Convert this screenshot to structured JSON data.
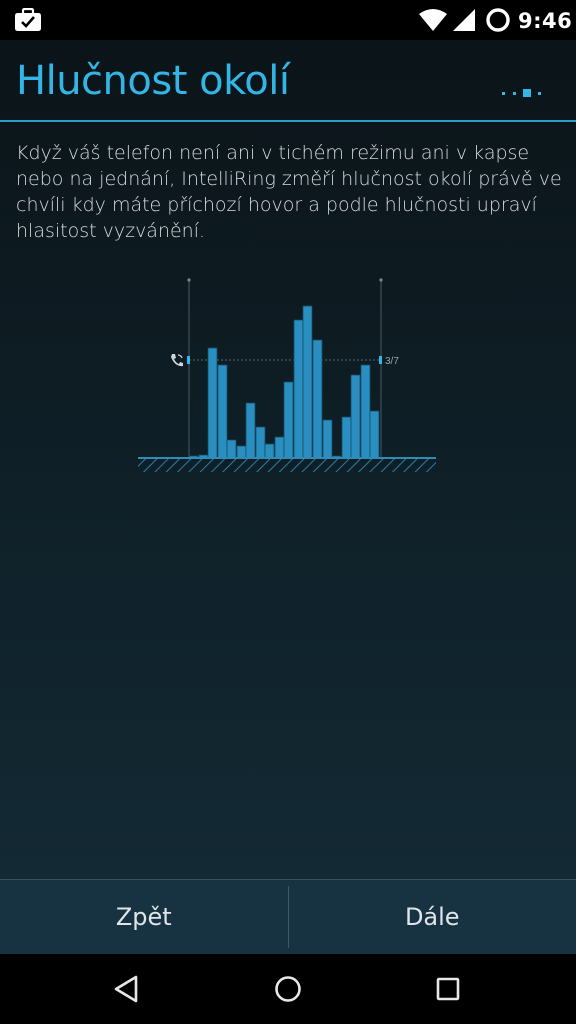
{
  "status_bar": {
    "time": "9:46",
    "icons": [
      "briefcase-icon",
      "wifi-icon",
      "signal-icon",
      "ring-icon"
    ]
  },
  "screen": {
    "title": "Hlučnost okolí",
    "description": "Když váš telefon není ani v tichém režimu ani v kapse nebo na jednání, IntelliRing změří hlučnost okolí právě ve chvíli kdy máte příchozí hovor a podle hlučnosti upraví hlasitost vyzvánění.",
    "page_indicator": {
      "count": 4,
      "active": 3
    }
  },
  "illustration": {
    "level_label": "3/7",
    "icons": [
      "phone-call-icon"
    ],
    "colors": {
      "bars": "#2a8fc0",
      "accent": "#33b5e5"
    }
  },
  "buttons": {
    "back": "Zpět",
    "next": "Dále"
  },
  "nav_bar": {
    "icons": [
      "back-icon",
      "home-icon",
      "recents-icon"
    ]
  },
  "colors": {
    "accent": "#33b5e5",
    "button_bar": "#173341",
    "background_top": "#0b1418",
    "background_bottom": "#142b36"
  }
}
